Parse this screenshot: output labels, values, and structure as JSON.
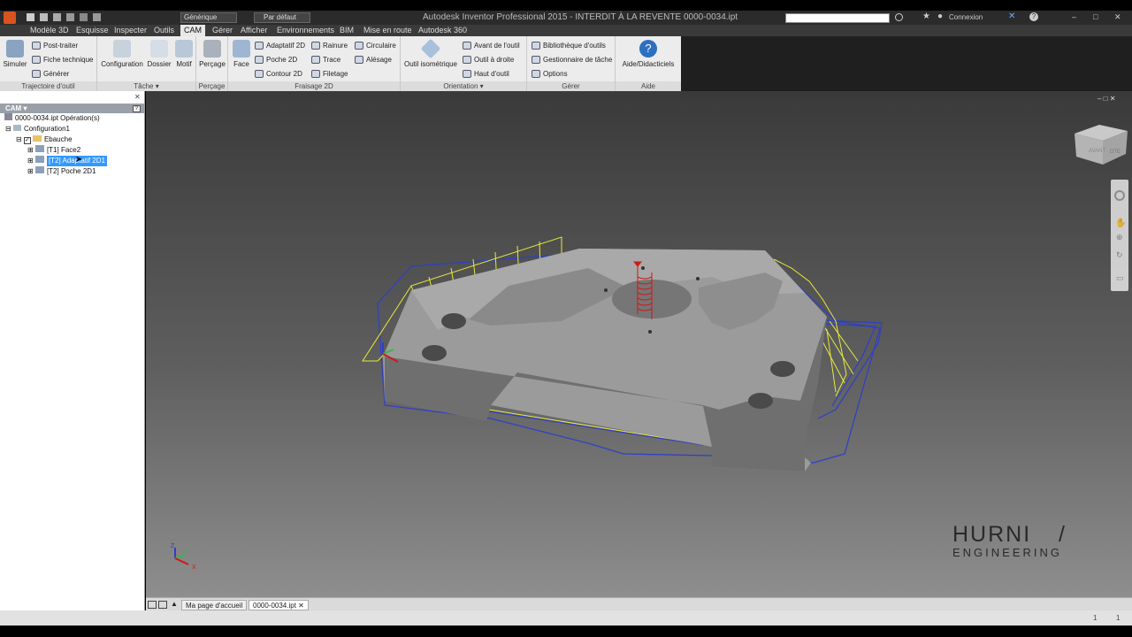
{
  "title_bar": {
    "title": "Autodesk Inventor Professional 2015 - INTERDIT À LA REVENTE    0000-0034.ipt",
    "material": "Générique",
    "appearance": "Par défaut",
    "connexion": "Connexion",
    "search_placeholder": ""
  },
  "tabs": [
    "Modèle 3D",
    "Esquisse",
    "Inspecter",
    "Outils",
    "CAM",
    "Gérer",
    "Afficher",
    "Environnements",
    "BIM",
    "Mise en route",
    "Autodesk 360"
  ],
  "ribbon": {
    "panels": {
      "trajectoire": "Trajectoire d'outil",
      "tache": "Tâche ▾",
      "percage": "Perçage",
      "fraisage": "Fraisage 2D",
      "orientation": "Orientation ▾",
      "gerer": "Gérer",
      "aide": "Aide"
    },
    "simuler": "Simuler",
    "post_traiter": "Post-traiter",
    "fiche_technique": "Fiche technique",
    "generer": "Générer",
    "configuration": "Configuration",
    "dossier": "Dossier",
    "motif": "Motif",
    "percage_btn": "Perçage",
    "face": "Face",
    "adaptatif2d": "Adaptatif 2D",
    "poche2d": "Poche 2D",
    "contour2d": "Contour 2D",
    "rainure": "Rainure",
    "trace": "Trace",
    "filetage": "Filetage",
    "circulaire": "Circulaire",
    "alesage": "Alésage",
    "outil_iso": "Outil isométrique",
    "avant_outil": "Avant de l'outil",
    "outil_droite": "Outil à droite",
    "haut_outil": "Haut d'outil",
    "bibliotheque": "Bibliothèque d'outils",
    "gestionnaire": "Gestionnaire de tâche",
    "options": "Options",
    "aide_btn": "Aide/Didacticiels"
  },
  "browser": {
    "header": "CAM ▾",
    "root": "0000-0034.ipt Opération(s)",
    "setup": "Configuration1",
    "folder": "Ebauche",
    "ops": [
      "[T1] Face2",
      "[T2] Adaptatif 2D1",
      "[T2] Poche 2D1"
    ]
  },
  "viewcube_labels": {
    "front": "AVANT",
    "right": "DTE"
  },
  "watermark": {
    "line1": "HURNI",
    "line2": "ENGINEERING"
  },
  "doc_tabs": [
    "Ma page d'accueil",
    "0000-0034.ipt"
  ],
  "status": {
    "left": "",
    "page": "1",
    "count": "1"
  },
  "triad_labels": {
    "x": "X",
    "y": "Y",
    "z": "Z"
  },
  "colors": {
    "part": "#8a8a8a",
    "toolpath_yellow": "#e8ea3c",
    "toolpath_blue": "#2e3fc8",
    "plunge_red": "#d01818",
    "selection": "#3399ff"
  }
}
